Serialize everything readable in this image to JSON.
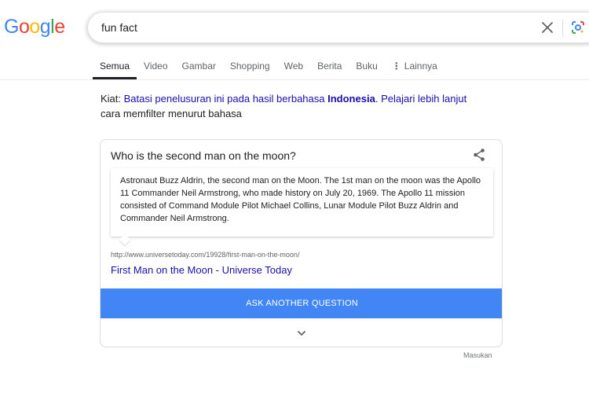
{
  "logo": {
    "letters": [
      {
        "ch": "G",
        "color": "#4285f4"
      },
      {
        "ch": "o",
        "color": "#ea4335"
      },
      {
        "ch": "o",
        "color": "#fbbc05"
      },
      {
        "ch": "g",
        "color": "#4285f4"
      },
      {
        "ch": "l",
        "color": "#34a853"
      },
      {
        "ch": "e",
        "color": "#ea4335"
      }
    ]
  },
  "search": {
    "value": "fun fact",
    "clear_icon": "close-icon",
    "lens_icon": "google-lens-icon"
  },
  "tabs": [
    {
      "label": "Semua",
      "active": true
    },
    {
      "label": "Video"
    },
    {
      "label": "Gambar"
    },
    {
      "label": "Shopping"
    },
    {
      "label": "Web"
    },
    {
      "label": "Berita"
    },
    {
      "label": "Buku"
    },
    {
      "label": "Lainnya",
      "icon": "more-vert-icon"
    }
  ],
  "tip": {
    "prefix": "Kiat:",
    "link1": "Batasi penelusuran ini pada hasil berbahasa",
    "link1_bold": "Indonesia",
    "period": ".",
    "link2": "Pelajari lebih lanjut",
    "suffix": "cara memfilter menurut bahasa"
  },
  "card": {
    "question": "Who is the second man on the moon?",
    "share_icon": "share-icon",
    "answer": "Astronaut Buzz Aldrin, the second man on the Moon. The 1st man on the moon was the Apollo 11 Commander Neil Armstrong, who made history on July 20, 1969. The Apollo 11 mission consisted of Command Module Pilot Michael Collins, Lunar Module Pilot Buzz Aldrin and Commander Neil Armstrong.",
    "source_url": "http://www.universetoday.com/19928/first-man-on-the-moon/",
    "source_title": "First Man on the Moon - Universe Today",
    "button_label": "ASK ANOTHER QUESTION",
    "expand_icon": "chevron-down-icon",
    "button_color": "#4285f4"
  },
  "feedback_label": "Masukan",
  "colors": {
    "link": "#1a0dab",
    "text": "#202124",
    "muted": "#5f6368"
  }
}
